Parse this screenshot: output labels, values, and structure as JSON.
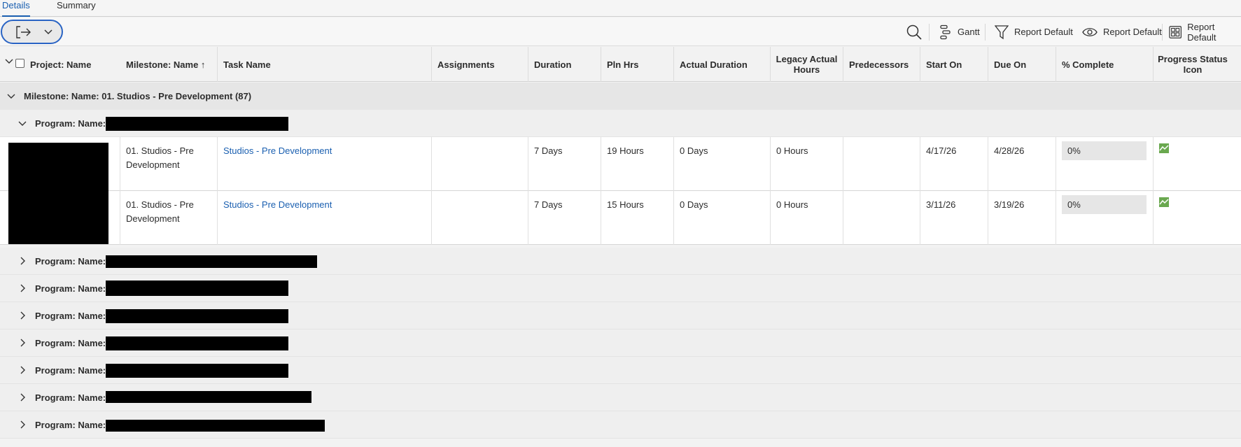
{
  "tabs": [
    {
      "label": "Details",
      "active": true
    },
    {
      "label": "Summary",
      "active": false
    }
  ],
  "toolbar": {
    "gantt_label": "Gantt",
    "filter_label": "Report Default",
    "view_label": "Report Default",
    "grouping_label": "Report Default"
  },
  "columns": {
    "project_name": "Project: Name",
    "milestone_name": "Milestone: Name ↑",
    "task_name": "Task Name",
    "assignments": "Assignments",
    "duration": "Duration",
    "pln_hrs": "Pln Hrs",
    "actual_duration": "Actual Duration",
    "legacy_actual_hours": "Legacy Actual Hours",
    "predecessors": "Predecessors",
    "start_on": "Start On",
    "due_on": "Due On",
    "pct_complete": "% Complete",
    "progress_status_icon": "Progress Status Icon"
  },
  "milestone_group": {
    "label": "Milestone: Name: 01. Studios - Pre Development (87)"
  },
  "program_groups": [
    {
      "label": "Program: Name: ",
      "expanded": true
    },
    {
      "label": "Program: Name: ",
      "expanded": false
    },
    {
      "label": "Program: Name: ",
      "expanded": false
    },
    {
      "label": "Program: Name: ",
      "expanded": false
    },
    {
      "label": "Program: Name: ",
      "expanded": false
    },
    {
      "label": "Program: Name: ",
      "expanded": false
    },
    {
      "label": "Program: Name: ",
      "expanded": false
    },
    {
      "label": "Program: Name: ",
      "expanded": false
    }
  ],
  "rows": [
    {
      "milestone": "01. Studios - Pre Development",
      "task": "Studios - Pre Development",
      "assignments": "",
      "duration": "7 Days",
      "pln_hrs": "19 Hours",
      "actual_duration": "0 Days",
      "legacy_actual_hours": "0 Hours",
      "predecessors": "",
      "start_on": "4/17/26",
      "due_on": "4/28/26",
      "pct_complete": "0%"
    },
    {
      "milestone": "01. Studios - Pre Development",
      "task": "Studios - Pre Development",
      "assignments": "",
      "duration": "7 Days",
      "pln_hrs": "15 Hours",
      "actual_duration": "0 Days",
      "legacy_actual_hours": "0 Hours",
      "predecessors": "",
      "start_on": "3/11/26",
      "due_on": "3/19/26",
      "pct_complete": "0%"
    }
  ],
  "colors": {
    "accent": "#1a5fb0",
    "status_icon": "#6aa84f",
    "redaction": "#000000"
  },
  "icons": [
    "export-icon",
    "chevron-down-icon",
    "search-icon",
    "gantt-icon",
    "filter-icon",
    "eye-icon",
    "grid-icon",
    "chevron-right-icon"
  ]
}
